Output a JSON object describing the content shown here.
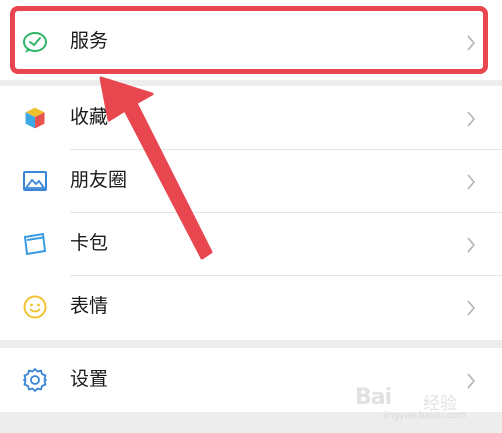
{
  "menu": {
    "service": {
      "label": "服务",
      "icon": "wechat-pay-icon"
    },
    "favorites": {
      "label": "收藏",
      "icon": "cube-icon"
    },
    "moments": {
      "label": "朋友圈",
      "icon": "picture-icon"
    },
    "cards": {
      "label": "卡包",
      "icon": "card-icon"
    },
    "stickers": {
      "label": "表情",
      "icon": "smiley-icon"
    },
    "settings": {
      "label": "设置",
      "icon": "gear-icon"
    }
  },
  "annotation": {
    "highlight_color": "#e8474f"
  },
  "watermark": {
    "brand": "Bai",
    "sub": "经验",
    "url": "jingyan.baidu.com"
  }
}
